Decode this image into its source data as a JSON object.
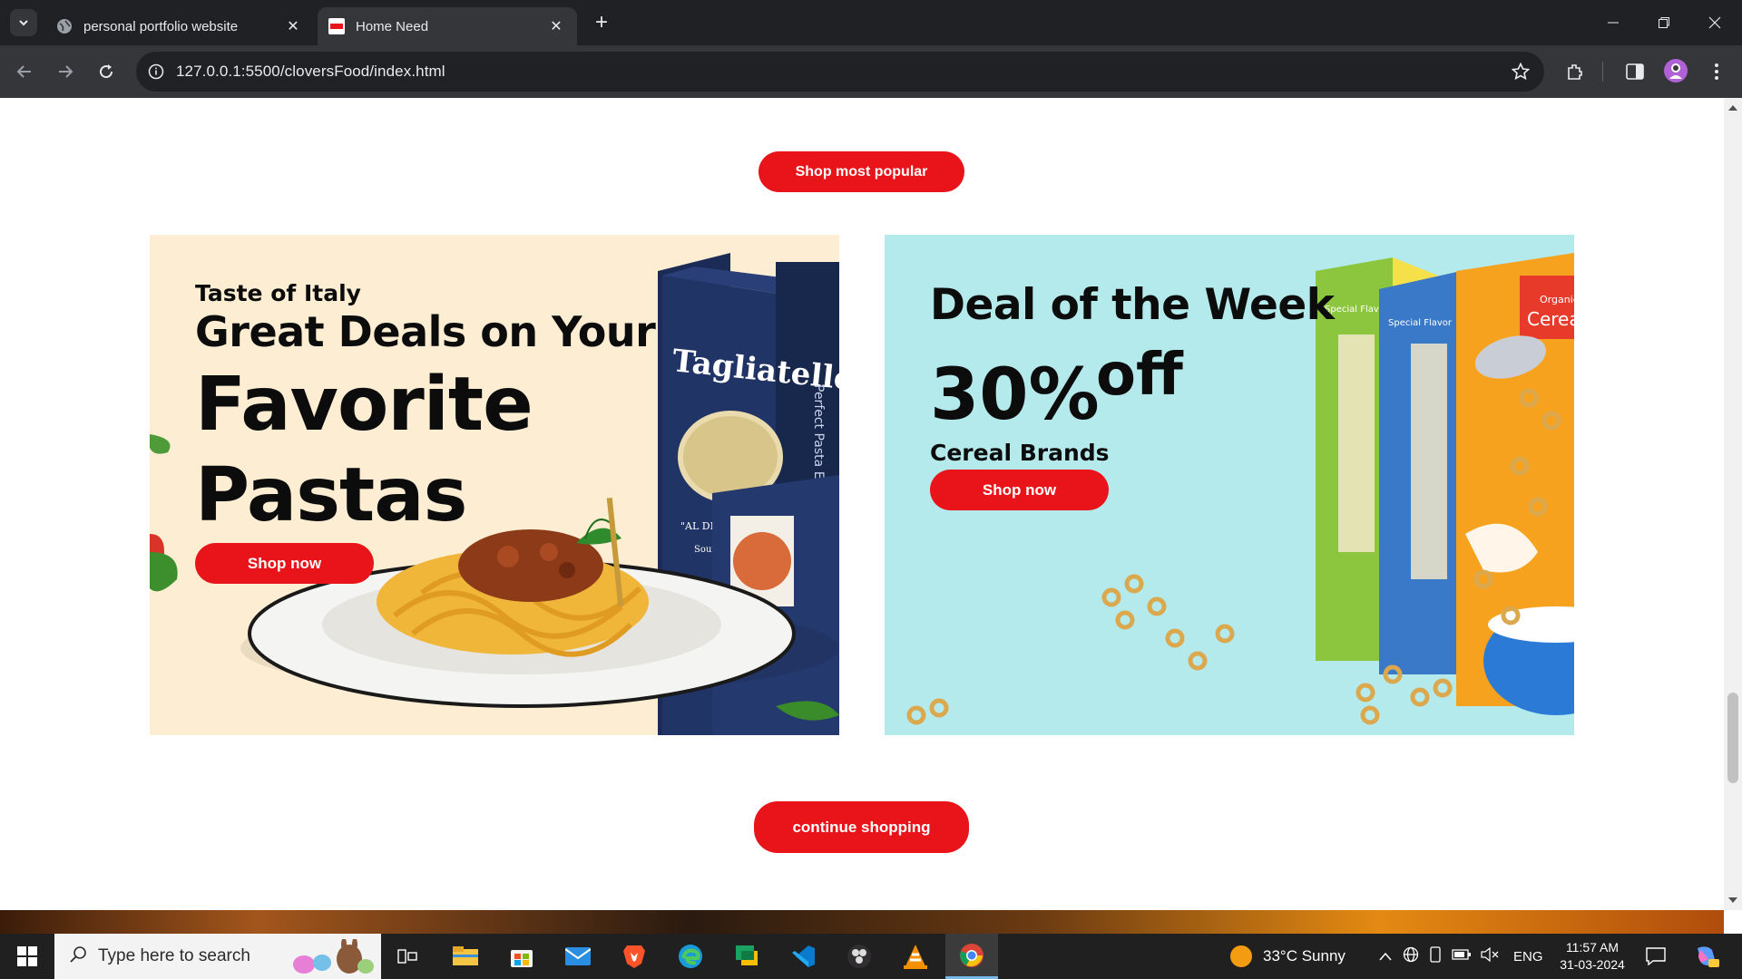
{
  "browser": {
    "tabs": [
      {
        "title": "personal portfolio website",
        "active": false
      },
      {
        "title": "Home Need",
        "active": true
      }
    ],
    "url": "127.0.0.1:5500/cloversFood/index.html"
  },
  "page": {
    "shop_popular_label": "Shop most popular",
    "banners": {
      "pasta": {
        "kicker": "Taste of Italy",
        "line1": "Great Deals on Your",
        "line2": "Favorite",
        "line3": "Pastas",
        "button": "Shop now",
        "box_brand": "Tagliatelle",
        "box_side": "Perfect Pasta Every",
        "box_tag": "\"AL DEN",
        "box_tag2": "Sourc"
      },
      "cereal": {
        "title": "Deal of the Week",
        "percent": "30%",
        "off": "off",
        "brands": "Cereal Brands",
        "button": "Shop now",
        "box1_label": "Special Flavor",
        "box2_label": "Special Flavor",
        "box3_label": "Organic",
        "box3_name": "Cereal"
      }
    },
    "continue_label": "continue shopping"
  },
  "taskbar": {
    "search_placeholder": "Type here to search",
    "weather": "33°C  Sunny",
    "language": "ENG",
    "time": "11:57 AM",
    "date": "31-03-2024"
  },
  "colors": {
    "accent_red": "#e8141a",
    "pasta_bg": "#fdeed3",
    "cereal_bg": "#b4eaec"
  }
}
